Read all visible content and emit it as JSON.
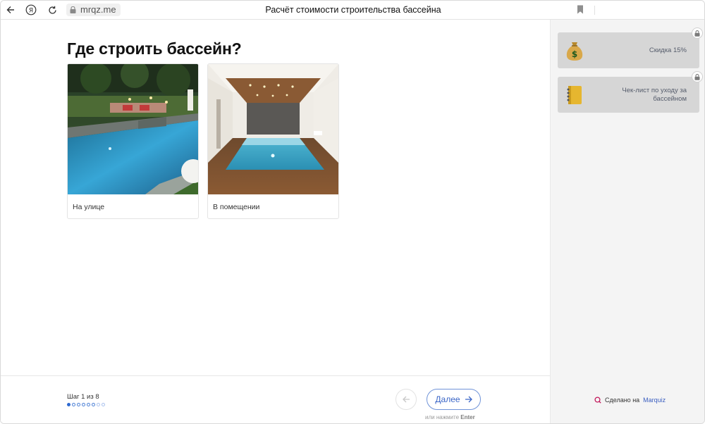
{
  "browser": {
    "url": "mrqz.me",
    "title": "Расчёт стоимости строительства бассейна"
  },
  "quiz": {
    "question": "Где строить бассейн?",
    "options": [
      {
        "label": "На улице",
        "image": "outdoor-pool-photo"
      },
      {
        "label": "В помещении",
        "image": "indoor-pool-photo"
      }
    ],
    "step_text": "Шаг 1 из 8",
    "current_step": 1,
    "total_steps": 8,
    "next_label": "Далее",
    "hint_prefix": "или нажмите",
    "hint_key": "Enter"
  },
  "sidebar": {
    "bonuses": [
      {
        "label": "Скидка 15%",
        "icon": "money-bag-icon",
        "locked": true
      },
      {
        "label": "Чек-лист по уходу за бассейном",
        "icon": "notebook-icon",
        "locked": true
      }
    ],
    "made_with_prefix": "Сделано на",
    "made_with_brand": "Marquiz"
  },
  "colors": {
    "accent": "#3b66c7",
    "sidebar_bg": "#f4f4f4",
    "bonus_bg": "#d6d6d6"
  }
}
